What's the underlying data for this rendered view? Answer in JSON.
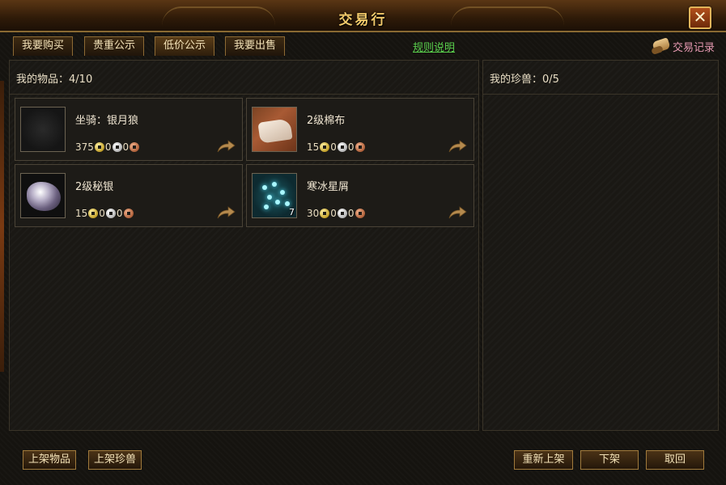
{
  "window": {
    "title": "交易行",
    "close_label": "✕"
  },
  "tabs": [
    {
      "label": "我要购买"
    },
    {
      "label": "贵重公示"
    },
    {
      "label": "低价公示"
    },
    {
      "label": "我要出售"
    }
  ],
  "rules_link": "规则说明",
  "trade_record": {
    "label": "交易记录",
    "icon": "scroll-icon"
  },
  "my_items": {
    "header_label": "我的物品",
    "separator": "：",
    "count": "4/10",
    "items": [
      {
        "name": "坐骑：银月狼",
        "gold": "375",
        "silver": "0",
        "copper": "0",
        "icon": "mount-icon",
        "qty": ""
      },
      {
        "name": "2级棉布",
        "gold": "15",
        "silver": "0",
        "copper": "0",
        "icon": "cloth-icon",
        "qty": ""
      },
      {
        "name": "2级秘银",
        "gold": "15",
        "silver": "0",
        "copper": "0",
        "icon": "mithril-ore-icon",
        "qty": ""
      },
      {
        "name": "寒冰星屑",
        "gold": "30",
        "silver": "0",
        "copper": "0",
        "icon": "ice-stardust-icon",
        "qty": "7"
      }
    ]
  },
  "my_pets": {
    "header_label": "我的珍兽",
    "separator": "：",
    "count": "0/5"
  },
  "bottom_buttons": {
    "list_item": "上架物品",
    "list_pet": "上架珍兽",
    "relist": "重新上架",
    "delist": "下架",
    "retrieve": "取回"
  },
  "colors": {
    "title": "#f2c96a",
    "rules_link": "#5ad14d",
    "trade_record": "#e79ab2",
    "panel_border": "#3a3428",
    "button_border": "#a07a3c"
  }
}
